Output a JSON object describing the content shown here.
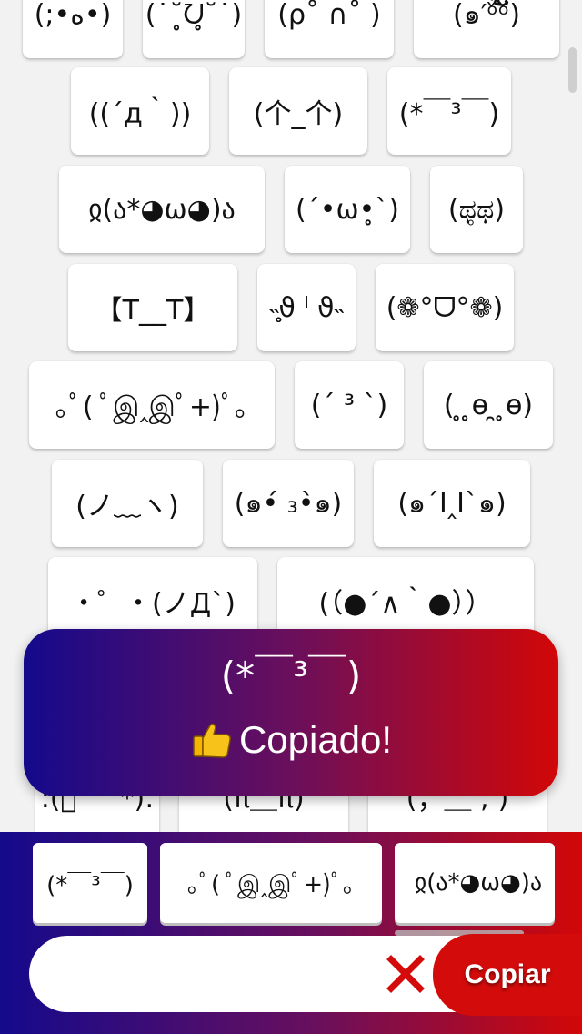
{
  "grid": {
    "rows": [
      [
        "(;•ﻩ•)",
        "(˙˘̥ᘢ̥˘˙)",
        "(ρ˚ ∩˚ )",
        "(๑′ᵒ̌̀ᵒ̌ັ)"
      ],
      [
        "((´д｀))",
        "(个_个)",
        "(*￣³￣)"
      ],
      [
        "ჲ(ა*◕ω◕)ა",
        "(´•ω•̥`)",
        "(ಥ̥ಥ)"
      ],
      [
        "【T__T】",
        "˵̥̥̥ϑ ˡ ϑ˵",
        "(❁°ᗜ°❁)"
      ],
      [
        "｡ﾟ( ﾟஇ‸இﾟ+)ﾟ｡",
        "(´ ³ `)",
        "( ̥ ̥ɵ ̯ ̥ɵ)"
      ],
      [
        "(ノ﹏ヽ)",
        "(๑•́ ₃•̀๑)",
        "(๑´Ⅰ‸Ⅰ`๑)"
      ],
      [
        "・゜・(ノД`)",
        "(（●´∧｀●））"
      ],
      [
        ":(ﾟ ꒪ﾟ*):",
        "(π＿π)",
        "(；＿ ; )"
      ]
    ]
  },
  "toast": {
    "emoticon": "(*￣³￣)",
    "message": "Copiado!",
    "icon": "thumbs-up-icon"
  },
  "history": [
    "(*￣³￣)",
    "｡ﾟ( ﾟஇ‸இﾟ+)ﾟ｡",
    "ჲ(ა*◕ω◕)ა"
  ],
  "input": {
    "value": "",
    "placeholder": ""
  },
  "actions": {
    "clear_icon": "close-x-icon",
    "copy_label": "Copiar"
  },
  "colors": {
    "gradient_start": "#140a8c",
    "gradient_end": "#d20707",
    "copy_button": "#d40b0b",
    "clear_x": "#d40b0b"
  }
}
